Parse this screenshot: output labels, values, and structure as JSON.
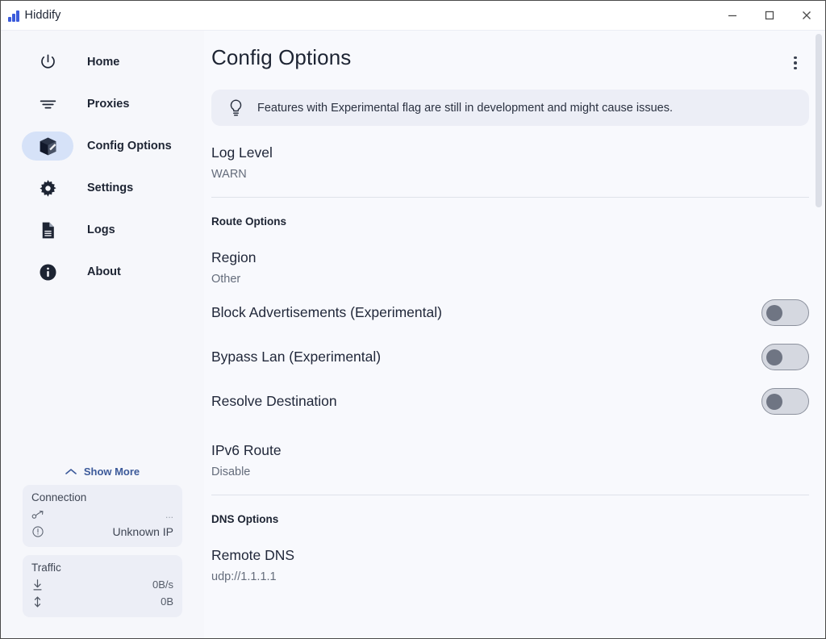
{
  "window": {
    "app_title": "Hiddify",
    "logo_color": "#3b5bdb",
    "controls": {
      "minimize": "Minimize",
      "maximize": "Maximize",
      "close": "Close"
    }
  },
  "sidebar": {
    "items": [
      {
        "label": "Home",
        "icon": "power-icon",
        "selected": false
      },
      {
        "label": "Proxies",
        "icon": "filter-icon",
        "selected": false
      },
      {
        "label": "Config Options",
        "icon": "box-icon",
        "selected": true
      },
      {
        "label": "Settings",
        "icon": "gear-icon",
        "selected": false
      },
      {
        "label": "Logs",
        "icon": "document-icon",
        "selected": false
      },
      {
        "label": "About",
        "icon": "info-icon",
        "selected": false
      }
    ],
    "show_more": "Show More",
    "connection": {
      "title": "Connection",
      "route_value": "...",
      "ip_value": "Unknown IP"
    },
    "traffic": {
      "title": "Traffic",
      "speed_value": "0B/s",
      "total_value": "0B"
    }
  },
  "main": {
    "page_title": "Config Options",
    "banner_text": "Features with Experimental flag are still in development and might cause issues.",
    "log_level": {
      "title": "Log Level",
      "value": "WARN"
    },
    "route_section_label": "Route Options",
    "region": {
      "title": "Region",
      "value": "Other"
    },
    "toggles": [
      {
        "title": "Block Advertisements (Experimental)",
        "on": false
      },
      {
        "title": "Bypass Lan (Experimental)",
        "on": false
      },
      {
        "title": "Resolve Destination",
        "on": false
      }
    ],
    "ipv6_route": {
      "title": "IPv6 Route",
      "value": "Disable"
    },
    "dns_section_label": "DNS Options",
    "remote_dns": {
      "title": "Remote DNS",
      "value": "udp://1.1.1.1"
    }
  },
  "colors": {
    "accent": "#3b5bdb",
    "selected_pill": "#d6e2f8",
    "surface": "#f8f9fd",
    "card": "#eceef6",
    "link": "#3c5a9a"
  }
}
